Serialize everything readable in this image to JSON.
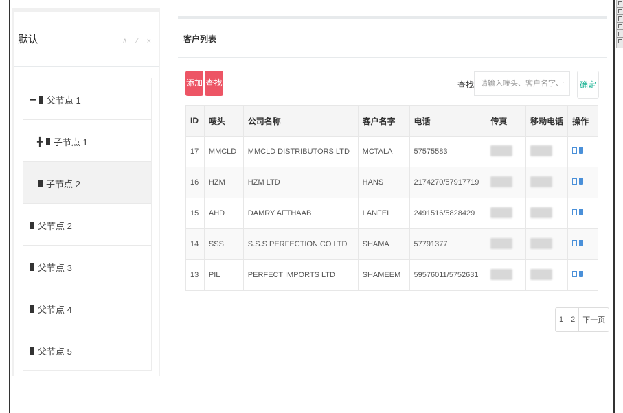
{
  "sidebar": {
    "title": "默认",
    "tools": "∧ ⁄ ×",
    "tree": [
      {
        "prefix": "━",
        "label": "父节点 1"
      },
      {
        "prefix": "╋",
        "label": "子节点 1"
      },
      {
        "prefix": "",
        "label": "子节点 2",
        "active": true
      },
      {
        "prefix": "",
        "label": "父节点 2"
      },
      {
        "prefix": "",
        "label": "父节点 3"
      },
      {
        "prefix": "",
        "label": "父节点 4"
      },
      {
        "prefix": "",
        "label": "父节点 5"
      }
    ]
  },
  "main": {
    "title": "客户列表",
    "add_label": "添加",
    "find_label": "查找",
    "search_label": "查找:",
    "search_placeholder": "请输入唛头、客户名字、公司名称",
    "ok_label": "确定"
  },
  "table": {
    "headers": [
      "ID",
      "唛头",
      "公司名称",
      "客户名字",
      "电话",
      "传真",
      "移动电话",
      "操作"
    ],
    "rows": [
      {
        "id": "17",
        "mark": "MMCLD",
        "company": "MMCLD DISTRIBUTORS LTD",
        "customer": "MCTALA",
        "phone": "57575583"
      },
      {
        "id": "16",
        "mark": "HZM",
        "company": "HZM LTD",
        "customer": "HANS",
        "phone": "2174270/57917719"
      },
      {
        "id": "15",
        "mark": "AHD",
        "company": "DAMRY AFTHAAB",
        "customer": "LANFEI",
        "phone": "2491516/5828429"
      },
      {
        "id": "14",
        "mark": "SSS",
        "company": "S.S.S PERFECTION CO LTD",
        "customer": "SHAMA",
        "phone": "57791377"
      },
      {
        "id": "13",
        "mark": "PIL",
        "company": "PERFECT IMPORTS LTD",
        "customer": "SHAMEEM",
        "phone": "59576011/5752631"
      }
    ]
  },
  "pager": [
    "1",
    "2",
    "下一页"
  ],
  "colors": {
    "accent_red": "#ed5565",
    "accent_green": "#1ab394",
    "icon_blue": "#4a90d9"
  }
}
